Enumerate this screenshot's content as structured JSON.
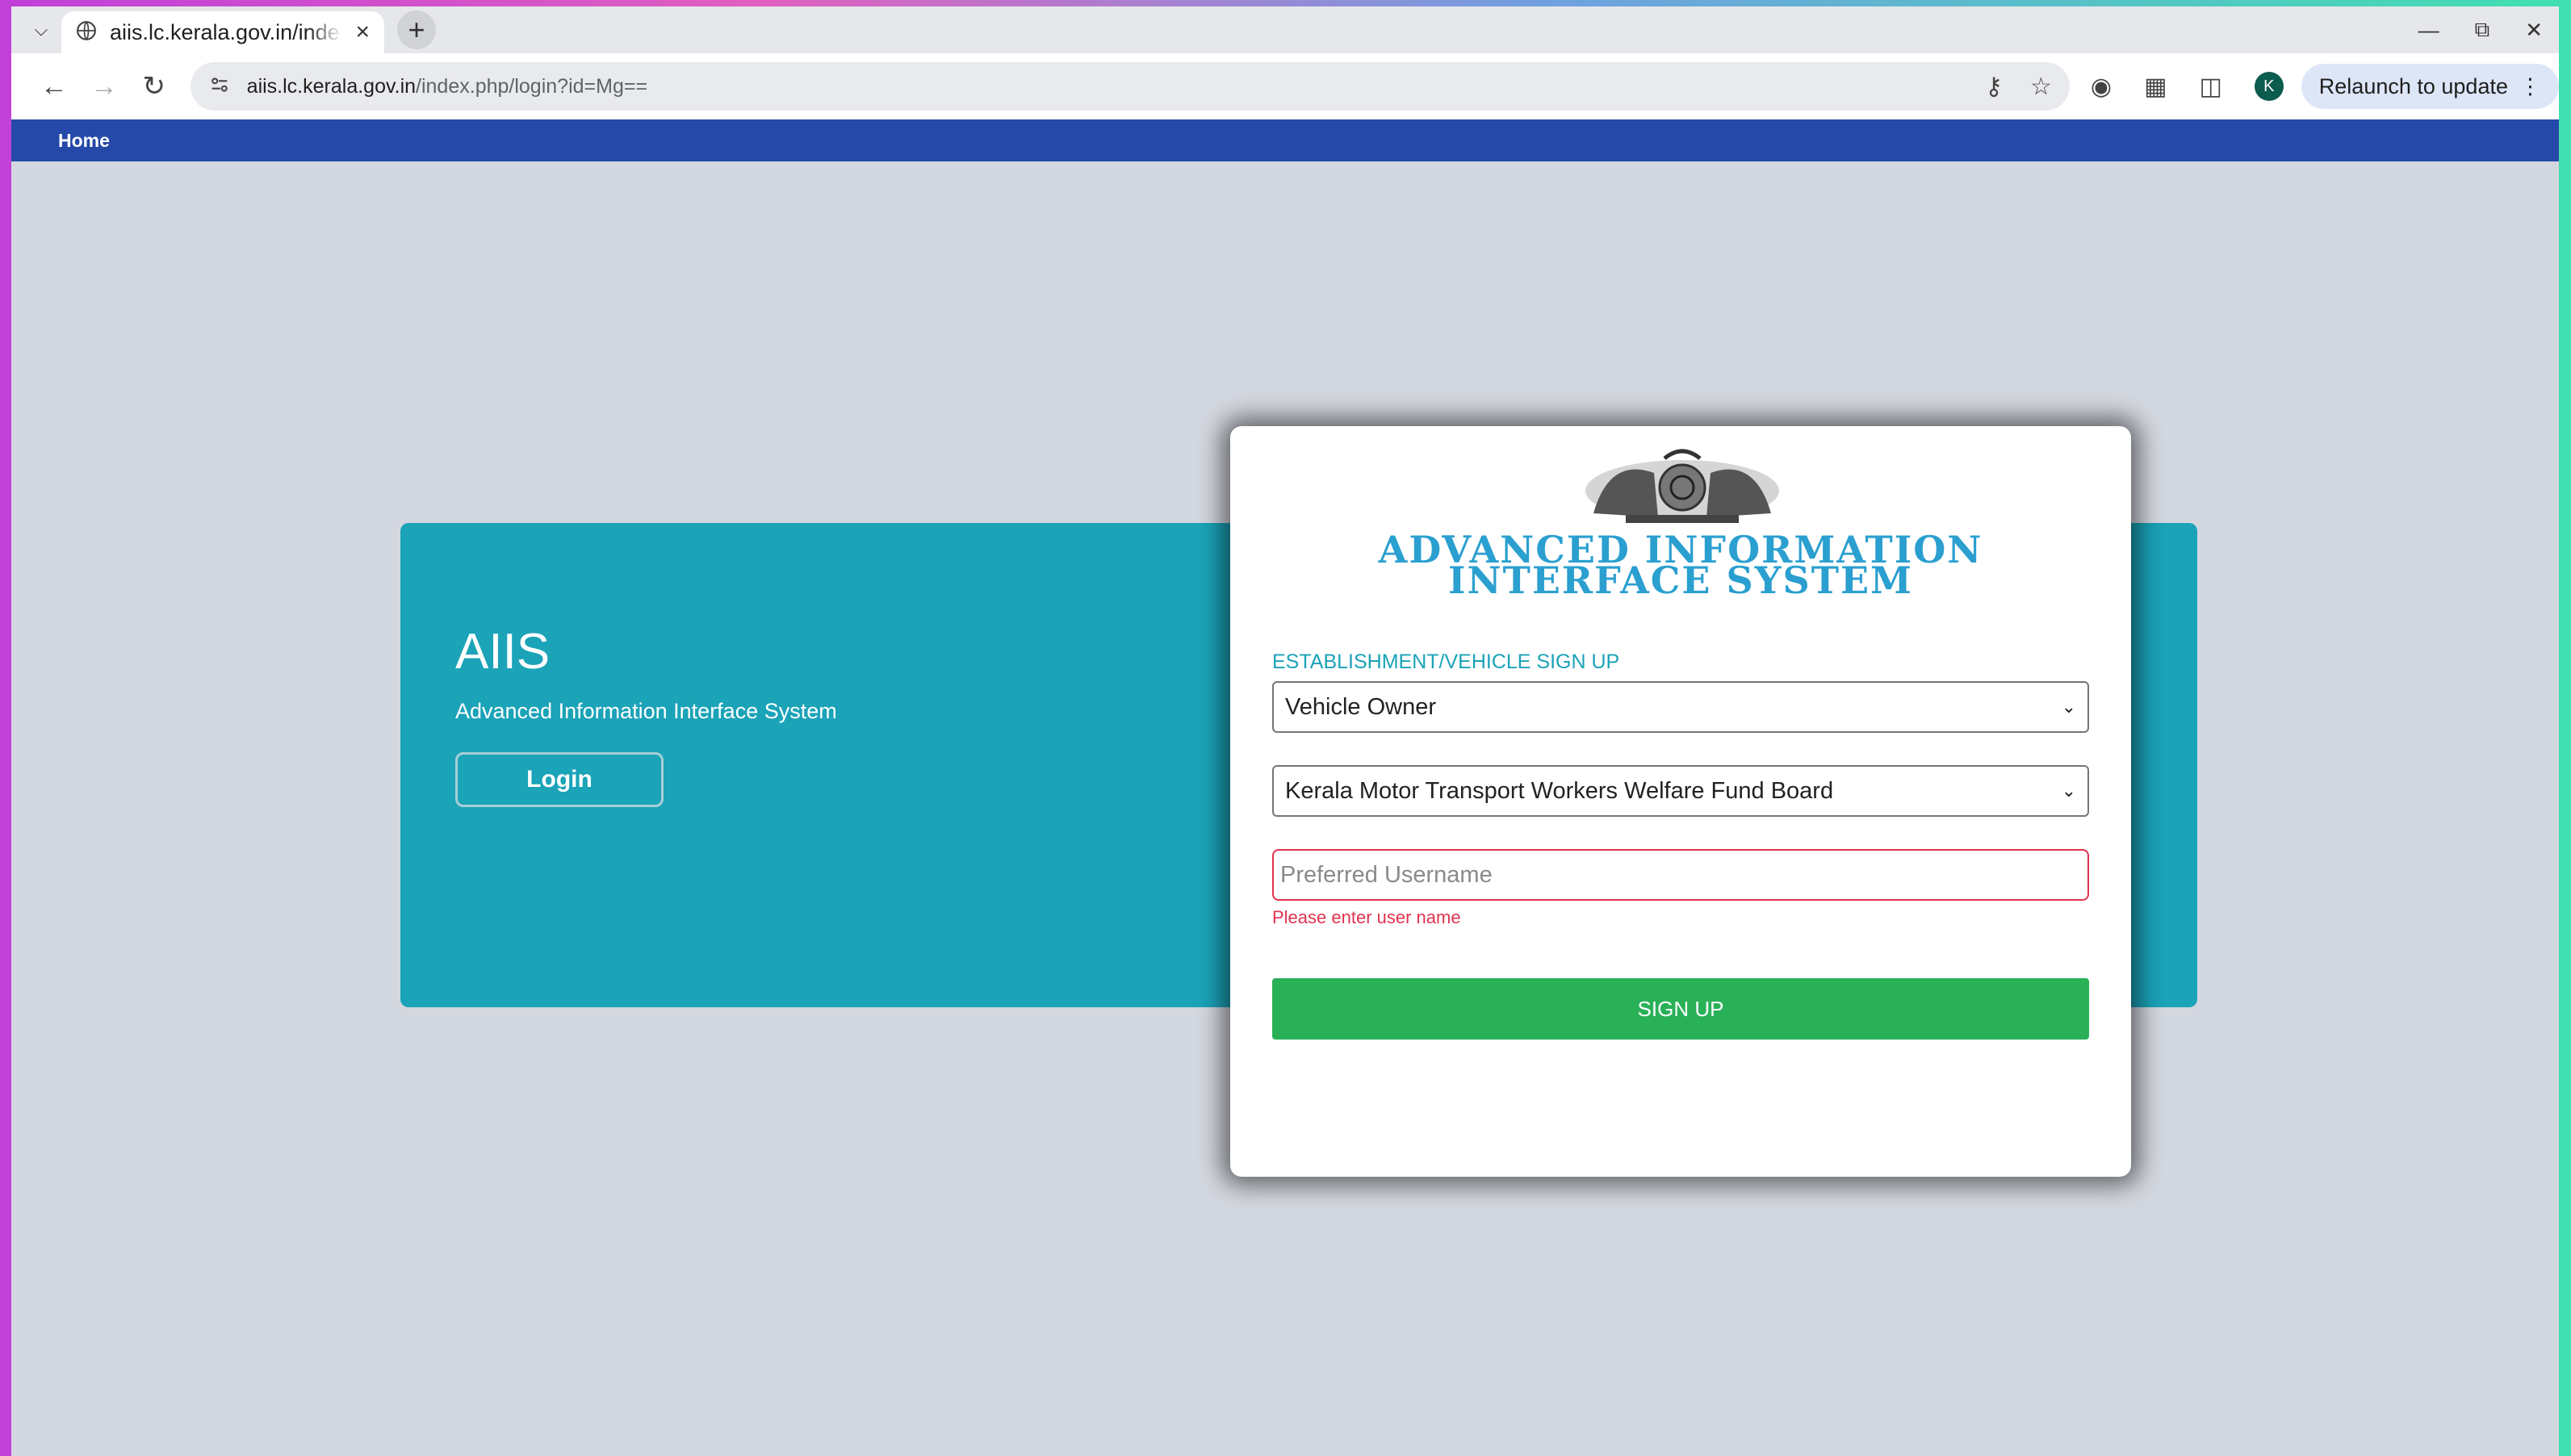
{
  "browser": {
    "tab_title": "aiis.lc.kerala.gov.in/index.php/login?id=Mg==",
    "url_host": "aiis.lc.kerala.gov.in",
    "url_path": "/index.php/login?id=Mg==",
    "avatar_letter": "K",
    "relaunch_label": "Relaunch to update"
  },
  "site_nav": {
    "home_label": "Home"
  },
  "hero": {
    "title": "AIIS",
    "subtitle": "Advanced Information Interface System",
    "login_label": "Login"
  },
  "card": {
    "brand_line1": "ADVANCED INFORMATION",
    "brand_line2": "INTERFACE SYSTEM",
    "section_label": "ESTABLISHMENT/VEHICLE SIGN UP",
    "category_select": "Vehicle Owner",
    "board_select": "Kerala Motor Transport Workers Welfare Fund Board",
    "username_placeholder": "Preferred Username",
    "username_error": "Please enter user name",
    "signup_label": "SIGN UP"
  },
  "colors": {
    "nav_bar": "#2449a8",
    "hero_teal": "#1ba3b8",
    "signup_green": "#2ab158",
    "error_red": "#e0334f",
    "brand_blue": "#2a9fd0"
  }
}
